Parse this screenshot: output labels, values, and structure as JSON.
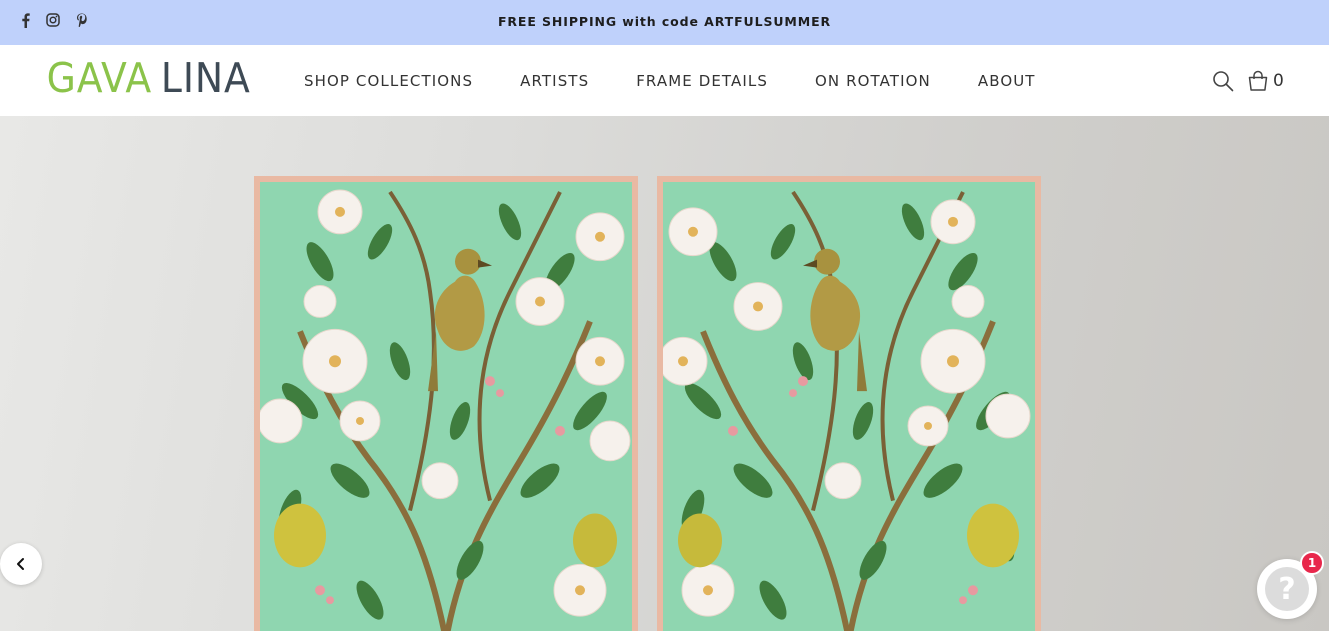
{
  "announcement": {
    "text": "FREE SHIPPING with code ARTFULSUMMER",
    "social_icons": [
      "facebook-icon",
      "instagram-icon",
      "pinterest-icon"
    ]
  },
  "header": {
    "logo_part1": "GAVA",
    "logo_part2": "LINA",
    "nav": [
      {
        "label": "SHOP COLLECTIONS"
      },
      {
        "label": "ARTISTS"
      },
      {
        "label": "FRAME DETAILS"
      },
      {
        "label": "ON ROTATION"
      },
      {
        "label": "ABOUT"
      }
    ],
    "cart_count": "0"
  },
  "hero": {
    "artwork_description_icon": "artwork-image"
  },
  "chat": {
    "unread_count": "1",
    "glyph": "?"
  },
  "colors": {
    "announcement_bg": "#bfd1fb",
    "logo_green": "#8bc34a",
    "logo_slate": "#3e4a55",
    "frame": "#e9b9a3",
    "artwork_bg": "#8fd6b0",
    "badge": "#e8274b"
  }
}
